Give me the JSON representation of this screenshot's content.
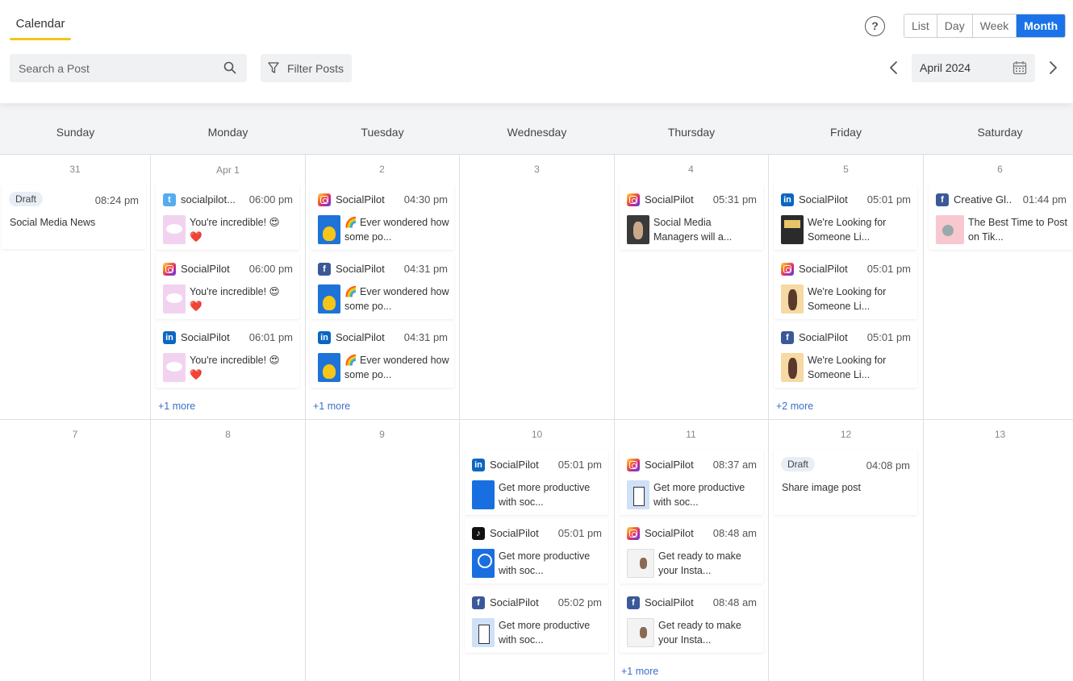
{
  "header": {
    "tab_calendar": "Calendar",
    "help": "?",
    "views": [
      "List",
      "Day",
      "Week",
      "Month"
    ],
    "search_placeholder": "Search a Post",
    "filter_label": "Filter Posts",
    "current_month": "April 2024"
  },
  "colors": {
    "accent": "#1a73e8",
    "tab_underline": "#f5c518",
    "link": "#3b6fc8"
  },
  "days": [
    "Sunday",
    "Monday",
    "Tuesday",
    "Wednesday",
    "Thursday",
    "Friday",
    "Saturday"
  ],
  "weeks": [
    {
      "dates": [
        "31",
        "Apr 1",
        "2",
        "3",
        "4",
        "5",
        "6"
      ],
      "cells": {
        "sun": {
          "draft": {
            "label": "Draft",
            "time": "08:24 pm",
            "title": "Social Media News"
          }
        },
        "mon": {
          "posts": [
            {
              "platform": "twitter-icon",
              "account": "socialpilot...",
              "time": "06:00 pm",
              "text": "You're incredible! 😍 ❤️"
            },
            {
              "platform": "instagram-icon",
              "account": "SocialPilot",
              "time": "06:00 pm",
              "text": "You're incredible! 😍 ❤️"
            },
            {
              "platform": "linkedin-icon",
              "account": "SocialPilot",
              "time": "06:01 pm",
              "text": "You're incredible! 😍 ❤️"
            }
          ],
          "more": "+1 more"
        },
        "tue": {
          "posts": [
            {
              "platform": "instagram-icon",
              "account": "SocialPilot",
              "time": "04:30 pm",
              "text": "🌈 Ever wondered how some po..."
            },
            {
              "platform": "facebook-icon",
              "account": "SocialPilot",
              "time": "04:31 pm",
              "text": "🌈 Ever wondered how some po..."
            },
            {
              "platform": "linkedin-icon",
              "account": "SocialPilot",
              "time": "04:31 pm",
              "text": "🌈 Ever wondered how some po..."
            }
          ],
          "more": "+1 more"
        },
        "thu": {
          "posts": [
            {
              "platform": "instagram-icon",
              "account": "SocialPilot",
              "time": "05:31 pm",
              "text": "Social Media Managers will a..."
            }
          ]
        },
        "fri": {
          "posts": [
            {
              "platform": "linkedin-icon",
              "account": "SocialPilot",
              "time": "05:01 pm",
              "text": "We're Looking for Someone Li..."
            },
            {
              "platform": "instagram-icon",
              "account": "SocialPilot",
              "time": "05:01 pm",
              "text": "We're Looking for Someone Li..."
            },
            {
              "platform": "facebook-icon",
              "account": "SocialPilot",
              "time": "05:01 pm",
              "text": "We're Looking for Someone Li..."
            }
          ],
          "more": "+2 more"
        },
        "sat": {
          "posts": [
            {
              "platform": "facebook-icon",
              "account": "Creative Gl...",
              "time": "01:44 pm",
              "text": "The Best Time to Post on Tik..."
            }
          ]
        }
      }
    },
    {
      "dates": [
        "7",
        "8",
        "9",
        "10",
        "11",
        "12",
        "13"
      ],
      "cells": {
        "wed": {
          "posts": [
            {
              "platform": "linkedin-icon",
              "account": "SocialPilot",
              "time": "05:01 pm",
              "text": "Get more productive with soc..."
            },
            {
              "platform": "tiktok-icon",
              "account": "SocialPilot",
              "time": "05:01 pm",
              "text": "Get more productive with soc..."
            },
            {
              "platform": "facebook-icon",
              "account": "SocialPilot",
              "time": "05:02 pm",
              "text": "Get more productive with soc..."
            }
          ]
        },
        "thu": {
          "posts": [
            {
              "platform": "instagram-icon",
              "account": "SocialPilot",
              "time": "08:37 am",
              "text": "Get more productive with soc..."
            },
            {
              "platform": "instagram-icon",
              "account": "SocialPilot",
              "time": "08:48 am",
              "text": "Get ready to make your Insta..."
            },
            {
              "platform": "facebook-icon",
              "account": "SocialPilot",
              "time": "08:48 am",
              "text": "Get ready to make your Insta..."
            }
          ],
          "more": "+1 more"
        },
        "fri": {
          "draft": {
            "label": "Draft",
            "time": "04:08 pm",
            "title": "Share image post"
          }
        }
      }
    }
  ]
}
